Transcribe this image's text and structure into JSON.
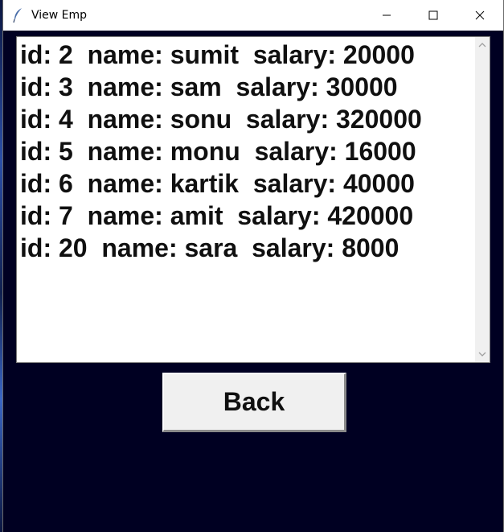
{
  "window": {
    "title": "View Emp",
    "background_color": "#000022"
  },
  "title_controls": [
    "minimize",
    "maximize",
    "close"
  ],
  "employee_list": {
    "items": [
      "id: 2  name: sumit  salary: 20000",
      "id: 3  name: sam  salary: 30000",
      "id: 4  name: sonu  salary: 320000",
      "id: 5  name: monu  salary: 16000",
      "id: 6  name: kartik  salary: 40000",
      "id: 7  name: amit  salary: 420000",
      "id: 20  name: sara  salary: 8000"
    ]
  },
  "back_button": {
    "label": "Back"
  },
  "icons": {
    "app": "feather-icon",
    "minimize": "minimize-icon",
    "maximize": "maximize-icon",
    "close": "close-icon",
    "scroll_up": "chevron-up-icon",
    "scroll_down": "chevron-down-icon"
  }
}
